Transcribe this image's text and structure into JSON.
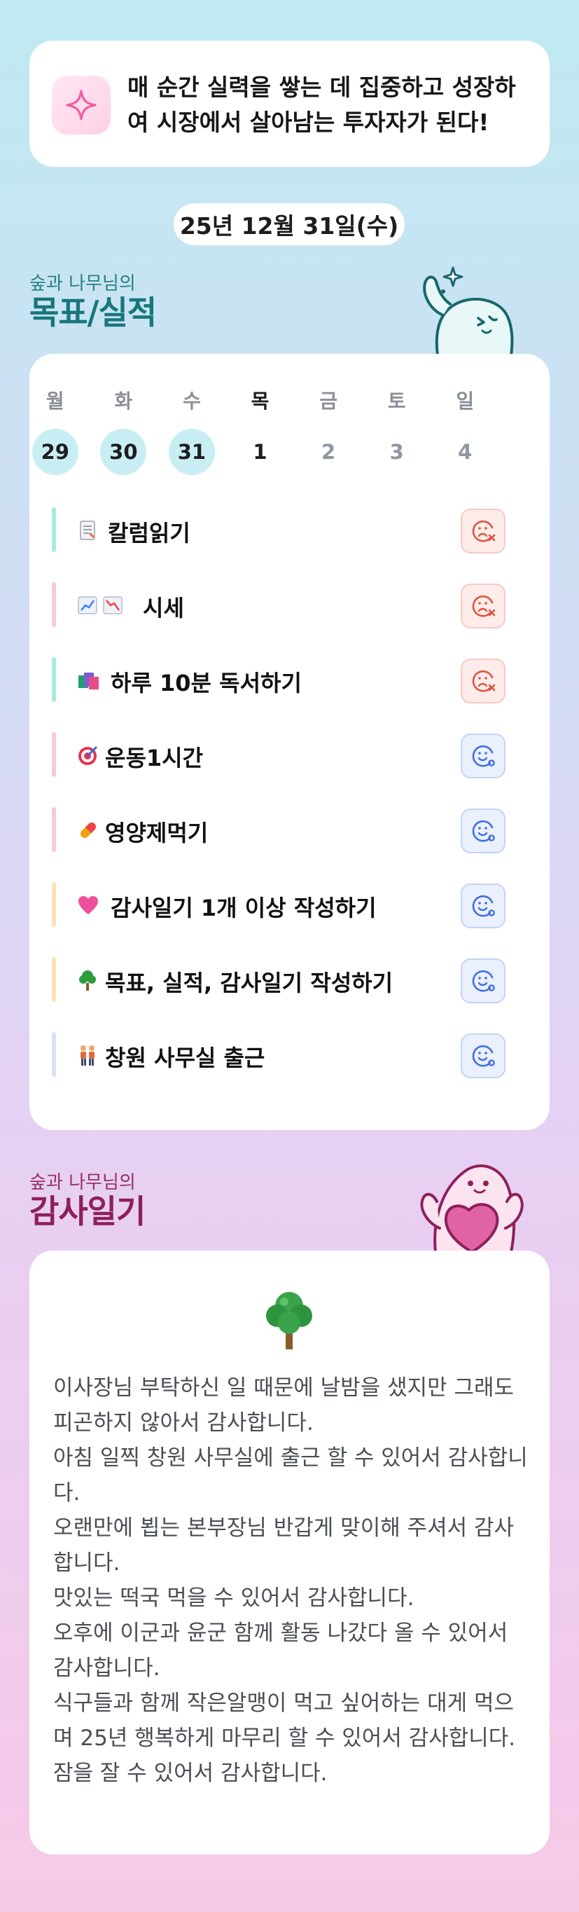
{
  "motto": {
    "icon": "sparkle-icon",
    "line1": "매 순간 실력을 쌓는 데 집중하고 성장하",
    "line2": "여 시장에서 살아남는 투자자가 된다!"
  },
  "date_label": "25년 12월 31일(수)",
  "goals_section": {
    "owner": "숲과 나무님의",
    "title": "목표/실적"
  },
  "week": {
    "days": [
      "월",
      "화",
      "수",
      "목",
      "금",
      "토",
      "일"
    ],
    "dates": [
      "29",
      "30",
      "31",
      "1",
      "2",
      "3",
      "4"
    ],
    "completed": [
      true,
      true,
      true,
      false,
      false,
      false,
      false
    ],
    "today_index": 3
  },
  "goals": [
    {
      "emoji": [
        "memo-icon"
      ],
      "label": "칼럼읽기",
      "status": "fail",
      "bar_color": "#a8ebe0"
    },
    {
      "emoji": [
        "chart-up-icon",
        "chart-down-icon"
      ],
      "label": "시세",
      "status": "fail",
      "bar_color": "#f8c9d6"
    },
    {
      "emoji": [
        "books-icon"
      ],
      "label": "하루 10분 독서하기",
      "status": "fail",
      "bar_color": "#a8ebe0"
    },
    {
      "emoji": [
        "target-icon"
      ],
      "label": "운동1시간",
      "status": "ok",
      "bar_color": "#f8c9d6"
    },
    {
      "emoji": [
        "pill-icon"
      ],
      "label": "영양제먹기",
      "status": "ok",
      "bar_color": "#f8c9d6"
    },
    {
      "emoji": [
        "heart-icon"
      ],
      "label": "감사일기 1개 이상 작성하기",
      "status": "ok",
      "bar_color": "#fde2b9"
    },
    {
      "emoji": [
        "tree-icon"
      ],
      "label": "목표, 실적, 감사일기 작성하기",
      "status": "ok",
      "bar_color": "#fde2b9"
    },
    {
      "emoji": [
        "people-icon"
      ],
      "label": "창원 사무실 출근",
      "status": "ok",
      "bar_color": "#d7e2f5"
    }
  ],
  "gratitude_section": {
    "owner": "숲과 나무님의",
    "title": "감사일기"
  },
  "gratitude": {
    "icon": "tree-icon",
    "lines": [
      "이사장님 부탁하신 일 때문에 날밤을 샜지만 그래도 피곤하지 않아서 감사합니다.",
      "아침 일찍 창원 사무실에 출근 할 수 있어서 감사합니다.",
      "오랜만에 뵙는 본부장님 반갑게 맞이해 주셔서 감사합니다.",
      "맛있는 떡국 먹을 수 있어서 감사합니다.",
      "오후에 이군과 윤군 함께 활동 나갔다 올 수 있어서 감사합니다.",
      "식구들과 함께 작은알맹이 먹고 싶어하는 대게 먹으며 25년 행복하게 마무리 할 수 있어서 감사합니다.",
      "잠을 잘 수 있어서 감사합니다."
    ]
  },
  "colors": {
    "accent_teal": "#17767c",
    "accent_magenta": "#8e1f5b",
    "fail": "#e0533f",
    "ok": "#3f6fe0",
    "completed_day": "#c8eef4"
  }
}
